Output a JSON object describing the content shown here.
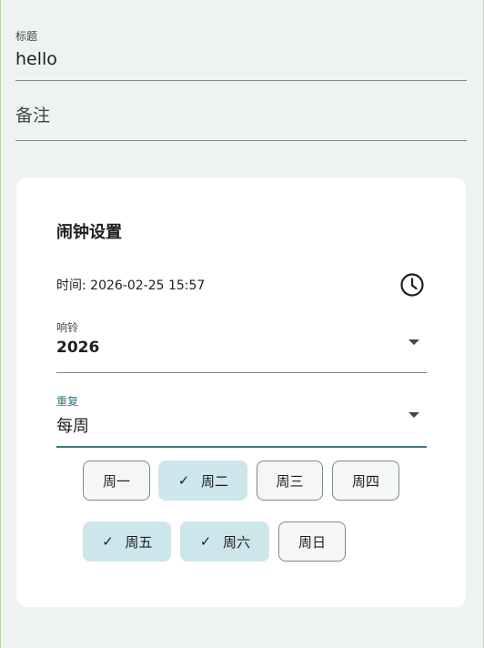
{
  "title_field": {
    "label": "标题",
    "value": "hello"
  },
  "note_field": {
    "placeholder": "备注"
  },
  "alarm_card": {
    "title": "闹钟设置",
    "time_text": "时间: 2026-02-25 15:57",
    "clock_icon": "clock-icon",
    "ring_select": {
      "label": "响铃",
      "value": "2026"
    },
    "repeat_select": {
      "label": "重复",
      "value": "每周"
    },
    "weekdays": [
      {
        "label": "周一",
        "selected": false
      },
      {
        "label": "周二",
        "selected": true
      },
      {
        "label": "周三",
        "selected": false
      },
      {
        "label": "周四",
        "selected": false
      },
      {
        "label": "周五",
        "selected": true
      },
      {
        "label": "周六",
        "selected": true
      },
      {
        "label": "周日",
        "selected": false
      }
    ],
    "check_glyph": "✓"
  },
  "colors": {
    "background": "#eef3f1",
    "card": "#ffffff",
    "accent": "#3d7480",
    "chip_selected": "#cde6ec"
  }
}
